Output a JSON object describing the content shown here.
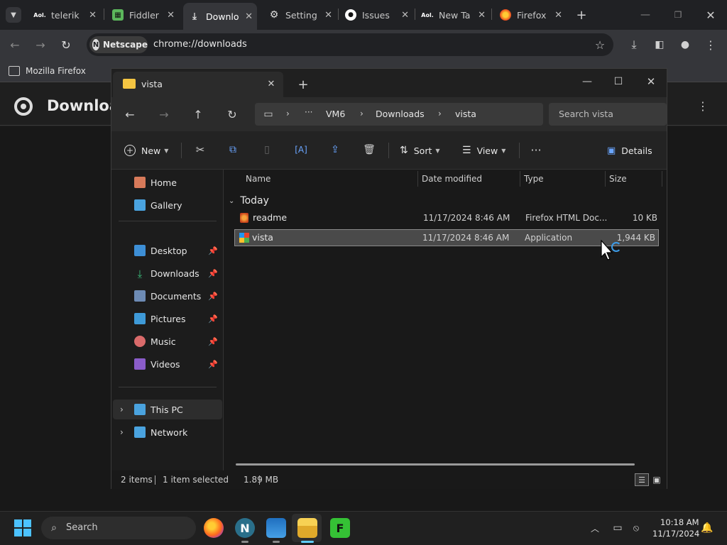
{
  "browser": {
    "tabs": [
      {
        "label": "telerik",
        "icon": "aol-icon"
      },
      {
        "label": "Fiddler",
        "icon": "fiddler-icon"
      },
      {
        "label": "Downlo",
        "icon": "download-icon",
        "active": true
      },
      {
        "label": "Setting",
        "icon": "gear-icon"
      },
      {
        "label": "Issues",
        "icon": "github-icon"
      },
      {
        "label": "New Ta",
        "icon": "aol-icon"
      },
      {
        "label": "Firefox",
        "icon": "firefox-icon"
      }
    ],
    "site_badge": "Netscape",
    "url": "chrome://downloads",
    "bookmark": "Mozilla Firefox",
    "page_title": "Downloa"
  },
  "explorer": {
    "tab_title": "vista",
    "breadcrumb": [
      "VM6",
      "Downloads",
      "vista"
    ],
    "search_placeholder": "Search vista",
    "commands": {
      "new": "New",
      "sort": "Sort",
      "view": "View",
      "details": "Details"
    },
    "sidebar": {
      "top": [
        {
          "label": "Home"
        },
        {
          "label": "Gallery"
        }
      ],
      "pinned": [
        {
          "label": "Desktop"
        },
        {
          "label": "Downloads"
        },
        {
          "label": "Documents"
        },
        {
          "label": "Pictures"
        },
        {
          "label": "Music"
        },
        {
          "label": "Videos"
        }
      ],
      "tree": [
        {
          "label": "This PC"
        },
        {
          "label": "Network"
        }
      ]
    },
    "columns": {
      "name": "Name",
      "date": "Date modified",
      "type": "Type",
      "size": "Size"
    },
    "group": "Today",
    "files": [
      {
        "name": "readme",
        "date": "11/17/2024 8:46 AM",
        "type": "Firefox HTML Doc...",
        "size": "10 KB"
      },
      {
        "name": "vista",
        "date": "11/17/2024 8:46 AM",
        "type": "Application",
        "size": "1,944 KB",
        "selected": true
      }
    ],
    "status": {
      "count": "2 items",
      "selection": "1 item selected",
      "size": "1.89 MB"
    }
  },
  "taskbar": {
    "search": "Search",
    "time": "10:18 AM",
    "date": "11/17/2024"
  },
  "colors": {
    "accent": "#60cdff",
    "selection": "#4a4a4a"
  }
}
